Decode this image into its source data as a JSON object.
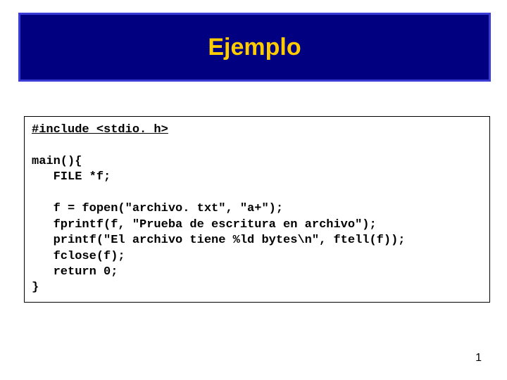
{
  "title": "Ejemplo",
  "code": {
    "include": "#include <stdio. h>",
    "l1": "",
    "l2": "main(){",
    "l3": "   FILE *f;",
    "l4": "",
    "l5": "   f = fopen(\"archivo. txt\", \"a+\");",
    "l6": "   fprintf(f, \"Prueba de escritura en archivo\");",
    "l7": "   printf(\"El archivo tiene %ld bytes\\n\", ftell(f));",
    "l8": "   fclose(f);",
    "l9": "   return 0;",
    "l10": "}"
  },
  "page_number": "1"
}
